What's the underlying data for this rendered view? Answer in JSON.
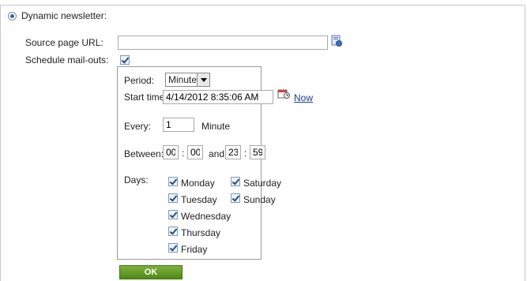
{
  "newsletter": {
    "type_label": "Dynamic newsletter:",
    "source_label": "Source page URL:",
    "source_value": "",
    "schedule_label": "Schedule mail-outs:"
  },
  "schedule": {
    "period_label": "Period:",
    "period_value": "Minute",
    "start_label": "Start time:",
    "start_value": "4/14/2012 8:35:06 AM",
    "now_label": "Now",
    "every_label": "Every:",
    "every_value": "1",
    "every_unit": "Minute",
    "between_label": "Between:",
    "from_hour": "00",
    "from_min": "00",
    "and_label": "and",
    "to_hour": "23",
    "to_min": "59",
    "sep": ":",
    "days_label": "Days:",
    "days": [
      "Monday",
      "Tuesday",
      "Wednesday",
      "Thursday",
      "Friday",
      "Saturday",
      "Sunday"
    ]
  },
  "actions": {
    "ok_label": "OK"
  },
  "icons": {
    "browse": "page-selector-icon",
    "calendar": "calendar-icon"
  }
}
